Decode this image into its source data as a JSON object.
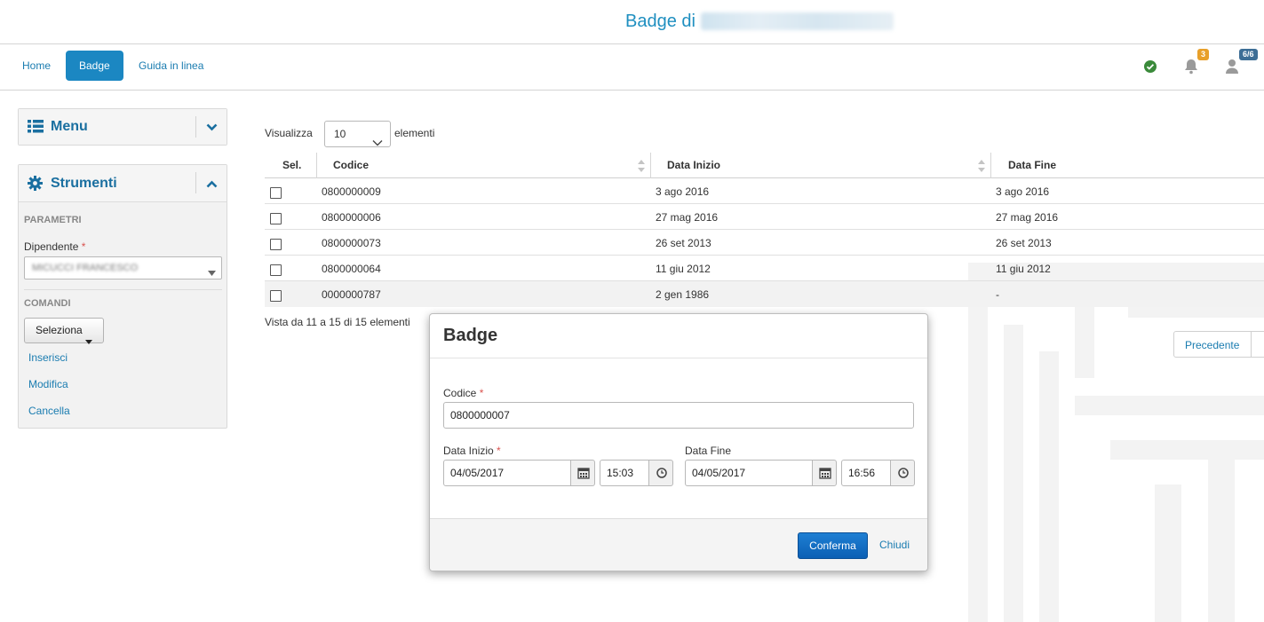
{
  "header": {
    "title": "Badge di"
  },
  "nav": {
    "links": [
      {
        "label": "Home"
      },
      {
        "label": "Badge",
        "active": true
      },
      {
        "label": "Guida in linea"
      }
    ],
    "notifications_count": "3",
    "user_badge": "6/6"
  },
  "sidebar": {
    "menu": {
      "title": "Menu"
    },
    "strumenti": {
      "title": "Strumenti",
      "section_parametri": "PARAMETRI",
      "dipendente_label": "Dipendente",
      "dipendente_value": "MICUCCI FRANCESCO",
      "section_comandi": "COMANDI",
      "seleziona_label": "Seleziona",
      "links": [
        "Inserisci",
        "Modifica",
        "Cancella"
      ]
    }
  },
  "table": {
    "visualizza_label": "Visualizza",
    "page_length": "10",
    "elementi_label": "elementi",
    "columns": [
      "Sel.",
      "Codice",
      "Data Inizio",
      "Data Fine"
    ],
    "rows": [
      {
        "codice": "0800000009",
        "inizio": "3 ago 2016",
        "fine": "3 ago 2016"
      },
      {
        "codice": "0800000006",
        "inizio": "27 mag 2016",
        "fine": "27 mag 2016"
      },
      {
        "codice": "0800000073",
        "inizio": "26 set 2013",
        "fine": "26 set 2013"
      },
      {
        "codice": "0800000064",
        "inizio": "11 giu 2012",
        "fine": "11 giu 2012"
      },
      {
        "codice": "0000000787",
        "inizio": "2 gen 1986",
        "fine": "-"
      }
    ],
    "info": "Vista da 11 a 15 di 15 elementi",
    "pager_prev": "Precedente"
  },
  "modal": {
    "title": "Badge",
    "codice_label": "Codice",
    "codice_value": "0800000007",
    "data_inizio_label": "Data Inizio",
    "data_inizio_date": "04/05/2017",
    "data_inizio_time": "15:03",
    "data_fine_label": "Data Fine",
    "data_fine_date": "04/05/2017",
    "data_fine_time": "16:56",
    "confirm_label": "Conferma",
    "close_label": "Chiudi",
    "required_mark": "*"
  },
  "colors": {
    "accent": "#1b87c2",
    "link": "#1a7cb0",
    "primary_button": "#0b5fb4",
    "status_ok": "#3a8a3a",
    "notification_badge": "#e8a02a",
    "user_badge": "#3d6e96"
  },
  "icons": [
    "check-circle-icon",
    "bell-icon",
    "user-icon",
    "list-icon",
    "gear-icon",
    "chevron-down-icon",
    "chevron-up-icon",
    "calendar-icon",
    "clock-icon",
    "sort-icon",
    "caret-down-icon"
  ]
}
